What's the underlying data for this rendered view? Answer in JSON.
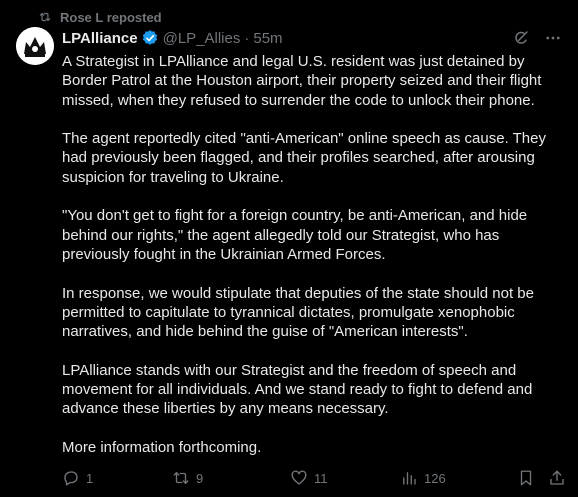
{
  "repost": {
    "text": "Rose L reposted",
    "icon": "repost-icon"
  },
  "author": {
    "name": "LPAlliance",
    "handle": "@LP_Allies",
    "separator": "·",
    "time": "55m",
    "avatar_icon": "lpalliance-logo",
    "verified_color": "#1d9bf0"
  },
  "post": {
    "paragraphs": [
      "A Strategist in LPAlliance and legal U.S. resident was just detained by Border Patrol at the Houston airport, their property seized and their flight missed, when they refused to surrender the code to unlock their phone.",
      "The agent reportedly cited \"anti-American\" online speech as cause. They had previously been flagged, and their profiles searched, after arousing suspicion for traveling to Ukraine.",
      "\"You don't get to fight for a foreign country, be anti-American, and hide behind our rights,\" the agent allegedly told our Strategist, who has previously fought in the Ukrainian Armed Forces.",
      "In response, we would stipulate that deputies of the state should not be permitted to capitulate to tyrannical dictates, promulgate xenophobic narratives, and hide behind the guise of \"American interests\".",
      "LPAlliance stands with our Strategist and the freedom of speech and movement for all individuals. And we stand ready to fight to defend and advance these liberties by any means necessary.",
      "More information forthcoming."
    ]
  },
  "actions": {
    "replies": "1",
    "reposts": "9",
    "likes": "11",
    "views": "126"
  },
  "colors": {
    "background": "#000000",
    "text": "#e7e9ea",
    "muted": "#71767b"
  }
}
